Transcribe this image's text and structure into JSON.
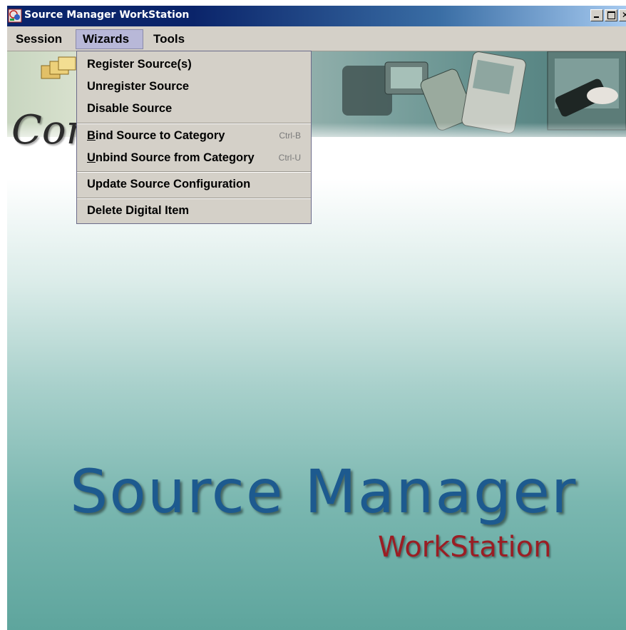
{
  "window": {
    "title": "Source Manager WorkStation"
  },
  "menubar": {
    "items": [
      {
        "label": "Session"
      },
      {
        "label": "Wizards"
      },
      {
        "label": "Tools"
      }
    ],
    "active": "Wizards"
  },
  "wizards_menu": {
    "items": [
      {
        "label": "Register Source(s)",
        "accelerator": ""
      },
      {
        "label": "Unregister Source",
        "accelerator": ""
      },
      {
        "label": "Disable Source",
        "accelerator": ""
      },
      {
        "mnemonic": "B",
        "rest": "ind Source to Category",
        "label": "Bind Source to Category",
        "accelerator": "Ctrl-B"
      },
      {
        "mnemonic": "U",
        "rest": "nbind Source from Category",
        "label": "Unbind Source from Category",
        "accelerator": "Ctrl-U"
      },
      {
        "label": "Update Source Configuration",
        "accelerator": ""
      },
      {
        "label": "Delete Digital Item",
        "accelerator": ""
      }
    ]
  },
  "splash": {
    "logo_fragment": "Con",
    "title": "Source Manager",
    "subtitle": "WorkStation"
  },
  "colors": {
    "titlebar": "#0a246a",
    "brand_title": "#1d5a8f",
    "brand_subtitle": "#9a1e24",
    "menu_active": "#b8b8d8"
  }
}
